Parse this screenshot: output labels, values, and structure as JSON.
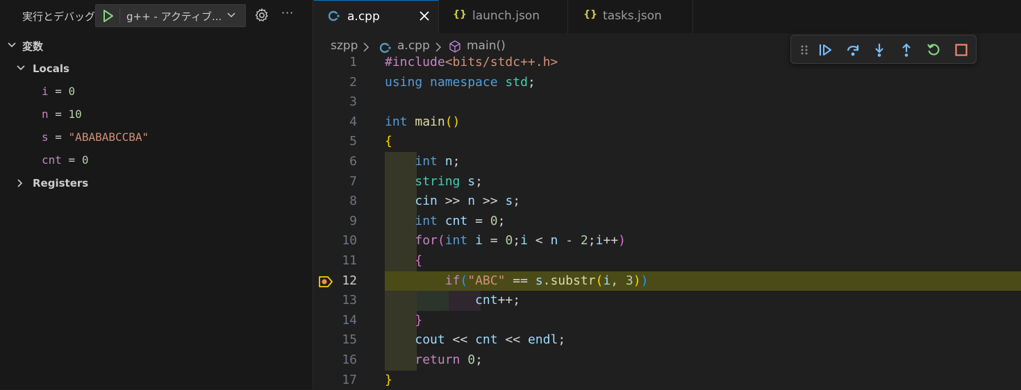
{
  "sidebar": {
    "title": "実行とデバッグ",
    "launch_config": "g++ - アクティブ...",
    "section_label": "変数",
    "locals_label": "Locals",
    "registers_label": "Registers",
    "variables": [
      {
        "name": "i",
        "eq": " = ",
        "value": "0",
        "kind": "num"
      },
      {
        "name": "n",
        "eq": " = ",
        "value": "10",
        "kind": "num"
      },
      {
        "name": "s",
        "eq": " = ",
        "value": "\"ABABABCCBA\"",
        "kind": "str"
      },
      {
        "name": "cnt",
        "eq": " = ",
        "value": "0",
        "kind": "num"
      }
    ],
    "more": "···"
  },
  "tabs": [
    {
      "label": "a.cpp",
      "icon": "C+",
      "active": true
    },
    {
      "label": "launch.json",
      "icon": "{}",
      "active": false
    },
    {
      "label": "tasks.json",
      "icon": "{}",
      "active": false
    }
  ],
  "breadcrumb": {
    "folder": "szpp",
    "file": "a.cpp",
    "symbol": "main()"
  },
  "debug_toolbar": [
    "grip-icon",
    "continue-icon",
    "step-over-icon",
    "step-into-icon",
    "step-out-icon",
    "restart-icon",
    "stop-icon"
  ],
  "editor": {
    "current_line": 12,
    "breakpoint_line": 12,
    "lines": [
      {
        "n": "1",
        "tokens": [
          [
            "pp",
            "#include"
          ],
          [
            "inc",
            "<bits/stdc++.h>"
          ]
        ]
      },
      {
        "n": "2",
        "tokens": [
          [
            "kw",
            "using"
          ],
          [
            "plain",
            " "
          ],
          [
            "kw",
            "namespace"
          ],
          [
            "plain",
            " "
          ],
          [
            "typ",
            "std"
          ],
          [
            "plain",
            ";"
          ]
        ]
      },
      {
        "n": "3",
        "tokens": []
      },
      {
        "n": "4",
        "tokens": [
          [
            "kw",
            "int"
          ],
          [
            "plain",
            " "
          ],
          [
            "fn",
            "main"
          ],
          [
            "p1",
            "()"
          ]
        ]
      },
      {
        "n": "5",
        "tokens": [
          [
            "p1",
            "{"
          ]
        ]
      },
      {
        "n": "6",
        "tokens": [
          [
            "plain",
            "    "
          ],
          [
            "kw",
            "int"
          ],
          [
            "plain",
            " "
          ],
          [
            "var",
            "n"
          ],
          [
            "plain",
            ";"
          ]
        ]
      },
      {
        "n": "7",
        "tokens": [
          [
            "plain",
            "    "
          ],
          [
            "typ",
            "string"
          ],
          [
            "plain",
            " "
          ],
          [
            "var",
            "s"
          ],
          [
            "plain",
            ";"
          ]
        ]
      },
      {
        "n": "8",
        "tokens": [
          [
            "plain",
            "    "
          ],
          [
            "var",
            "cin"
          ],
          [
            "plain",
            " >> "
          ],
          [
            "var",
            "n"
          ],
          [
            "plain",
            " >> "
          ],
          [
            "var",
            "s"
          ],
          [
            "plain",
            ";"
          ]
        ]
      },
      {
        "n": "9",
        "tokens": [
          [
            "plain",
            "    "
          ],
          [
            "kw",
            "int"
          ],
          [
            "plain",
            " "
          ],
          [
            "var",
            "cnt"
          ],
          [
            "plain",
            " = "
          ],
          [
            "num",
            "0"
          ],
          [
            "plain",
            ";"
          ]
        ]
      },
      {
        "n": "10",
        "tokens": [
          [
            "plain",
            "    "
          ],
          [
            "ctl",
            "for"
          ],
          [
            "p2",
            "("
          ],
          [
            "kw",
            "int"
          ],
          [
            "plain",
            " "
          ],
          [
            "var",
            "i"
          ],
          [
            "plain",
            " = "
          ],
          [
            "num",
            "0"
          ],
          [
            "plain",
            ";"
          ],
          [
            "var",
            "i"
          ],
          [
            "plain",
            " < "
          ],
          [
            "var",
            "n"
          ],
          [
            "plain",
            " - "
          ],
          [
            "num",
            "2"
          ],
          [
            "plain",
            ";"
          ],
          [
            "var",
            "i"
          ],
          [
            "plain",
            "++"
          ],
          [
            "p2",
            ")"
          ]
        ]
      },
      {
        "n": "11",
        "tokens": [
          [
            "plain",
            "    "
          ],
          [
            "p2",
            "{"
          ]
        ]
      },
      {
        "n": "12",
        "tokens": [
          [
            "plain",
            "        "
          ],
          [
            "ctl",
            "if"
          ],
          [
            "p3",
            "("
          ],
          [
            "str",
            "\"ABC\""
          ],
          [
            "plain",
            " == "
          ],
          [
            "var",
            "s"
          ],
          [
            "plain",
            "."
          ],
          [
            "fn",
            "substr"
          ],
          [
            "p1",
            "("
          ],
          [
            "var",
            "i"
          ],
          [
            "plain",
            ", "
          ],
          [
            "num",
            "3"
          ],
          [
            "p1",
            ")"
          ],
          [
            "p3",
            ")"
          ]
        ]
      },
      {
        "n": "13",
        "tokens": [
          [
            "plain",
            "            "
          ],
          [
            "var",
            "cnt"
          ],
          [
            "plain",
            "++;"
          ]
        ]
      },
      {
        "n": "14",
        "tokens": [
          [
            "plain",
            "    "
          ],
          [
            "p2",
            "}"
          ]
        ]
      },
      {
        "n": "15",
        "tokens": [
          [
            "plain",
            "    "
          ],
          [
            "var",
            "cout"
          ],
          [
            "plain",
            " << "
          ],
          [
            "var",
            "cnt"
          ],
          [
            "plain",
            " << "
          ],
          [
            "var",
            "endl"
          ],
          [
            "plain",
            ";"
          ]
        ]
      },
      {
        "n": "16",
        "tokens": [
          [
            "plain",
            "    "
          ],
          [
            "ctl",
            "return"
          ],
          [
            "plain",
            " "
          ],
          [
            "num",
            "0"
          ],
          [
            "plain",
            ";"
          ]
        ]
      },
      {
        "n": "17",
        "tokens": [
          [
            "p1",
            "}"
          ]
        ]
      }
    ]
  },
  "colors": {
    "accent": "#0078d4",
    "current_line_bg": "#4b4b18",
    "breakpoint": "#f48771"
  }
}
